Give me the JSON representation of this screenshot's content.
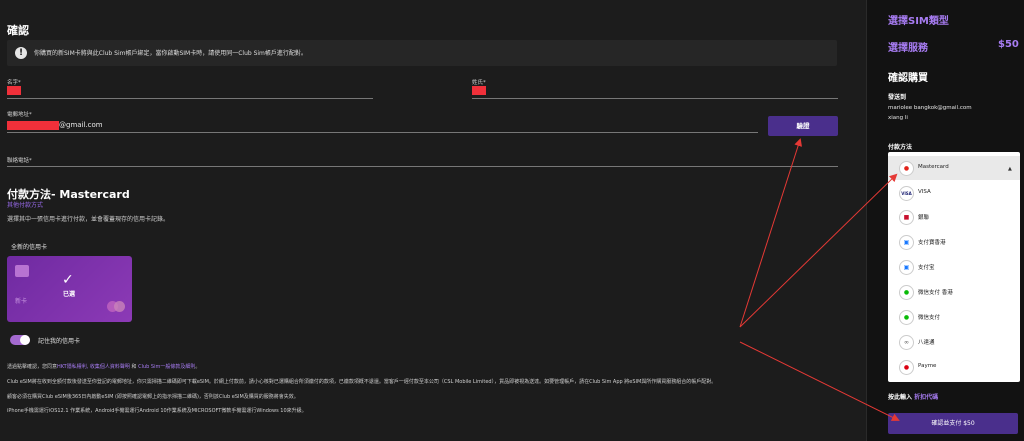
{
  "main": {
    "title": "確認",
    "notice": "你購買的新SIM卡將與此Club Sim帳戶綁定，當你啟動SIM卡時，請使用同一Club Sim帳戶進行配對。",
    "first_name_label": "名字*",
    "last_name_label": "姓氏*",
    "email_label": "電郵地址*",
    "email_suffix": "@gmail.com",
    "verify_button": "驗證",
    "phone_label": "聯絡電話*",
    "payment_title": "付款方法- Mastercard",
    "alt_payment_link": "其他付款方式",
    "payment_hint": "選擇其中一張信用卡進行付款，並會覆蓋現存的信用卡記錄。",
    "new_card_label": "全新的信用卡",
    "card_selected": "已選",
    "card_name": "新卡",
    "remember_card": "記住我的信用卡",
    "legal_1a": "透過點擊確認，您同意",
    "legal_1_link": "HKT隱私權利, 收集個人資料聲明",
    "legal_1b": "和",
    "legal_1_link2": "Club Sim一般條款及細則",
    "legal_1c": "。",
    "legal_2": "Club eSIM將在收到全額付款後發送至你登記的電郵地址，你只需掃描二維碼即可下載eSIM。於網上付款前，請小心核對已選購組合所須繳付的款項，已繳款項概不退還。當客戶一經付款至本公司（CSL Mobile Limited），貨品即被視為送達。如要管理帳戶，請在Club Sim App 將eSIM與所作購買服務組合的帳戶配對。",
    "legal_3": "顧客必須在購買Club eSIM後365日內啟動eSIM (即按照確認電郵上的指示掃描二維碼)，否則該Club eSIM及購買的服務將會失效。",
    "legal_4": "iPhone手機需運行iOS12.1 作業系統，Android手機需運行Android 10作業系統及MICROSOFT微軟手機需運行Windows 10來升級。"
  },
  "sidebar": {
    "title": "選擇SIM類型",
    "service_label": "選擇服務",
    "service_price": "$50",
    "confirm_title": "確認購買",
    "send_to_label": "發送到",
    "email": "mariolee bangkok@gmail.com",
    "name": "xiang li",
    "payment_label": "付款方法",
    "options": [
      {
        "label": "Mastercard",
        "icon": "mastercard-icon"
      },
      {
        "label": "VISA",
        "icon": "visa-icon"
      },
      {
        "label": "銀聯",
        "icon": "unionpay-icon"
      },
      {
        "label": "支付寶香港",
        "icon": "alipayhk-icon"
      },
      {
        "label": "支付宝",
        "icon": "alipay-icon"
      },
      {
        "label": "微信支付 香港",
        "icon": "wechatpay-hk-icon"
      },
      {
        "label": "微信支付",
        "icon": "wechatpay-icon"
      },
      {
        "label": "八達通",
        "icon": "octopus-icon"
      },
      {
        "label": "Payme",
        "icon": "payme-icon"
      }
    ],
    "promo_label": "按此輸入",
    "promo_link": "折扣代碼",
    "pay_button": "確認並支付 $50"
  },
  "colors": {
    "accent": "#a77cf2",
    "button": "#4a2f8c",
    "card": "#7a30a8",
    "redaction": "#f0303a"
  }
}
